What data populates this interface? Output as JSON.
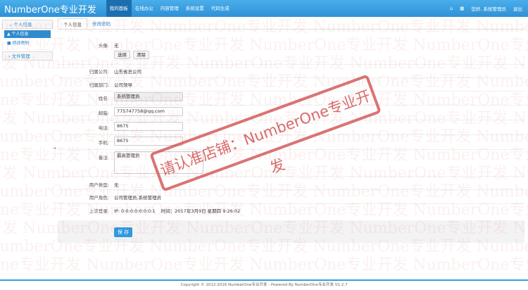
{
  "header": {
    "brand": "NumberOne专业开发",
    "nav": [
      "我的面板",
      "在线办公",
      "内容管理",
      "系统设置",
      "代码生成"
    ],
    "greeting": "您好, 系统管理员",
    "logout": "退出"
  },
  "sidebar": {
    "group1": "个人信息",
    "items": [
      "个人信息",
      "修改密码"
    ],
    "group2": "文件管理"
  },
  "tabs": [
    "个人信息",
    "修改密码"
  ],
  "form": {
    "avatar_label": "头像:",
    "avatar_value": "无",
    "choose": "选择",
    "clear": "清除",
    "company_label": "归属公司:",
    "company": "山东省总公司",
    "dept_label": "归属部门:",
    "dept": "公司领导",
    "name_label": "姓名:",
    "name": "系统管理员",
    "email_label": "邮箱:",
    "email": "775747758@qq.com",
    "phone_label": "电话:",
    "phone": "8675",
    "mobile_label": "手机:",
    "mobile": "8675",
    "remark_label": "备注:",
    "remark": "最高管理员",
    "usertype_label": "用户类型:",
    "usertype": "无",
    "role_label": "用户角色:",
    "role": "公司管理员,系统管理员",
    "lastlogin_label": "上次登录:",
    "lastlogin": "IP: 0:0:0:0:0:0:0:1    时间：2017年3月9日 星期四 9:26:02",
    "save": "保 存"
  },
  "watermark": "NumberOne专业开发",
  "stamp": "请认准店铺：NumberOne专业开发",
  "footer": "Copyright © 2012-2016 NumberOne专业开发 - Powered By NumberOne专业开发 V1.2.7"
}
